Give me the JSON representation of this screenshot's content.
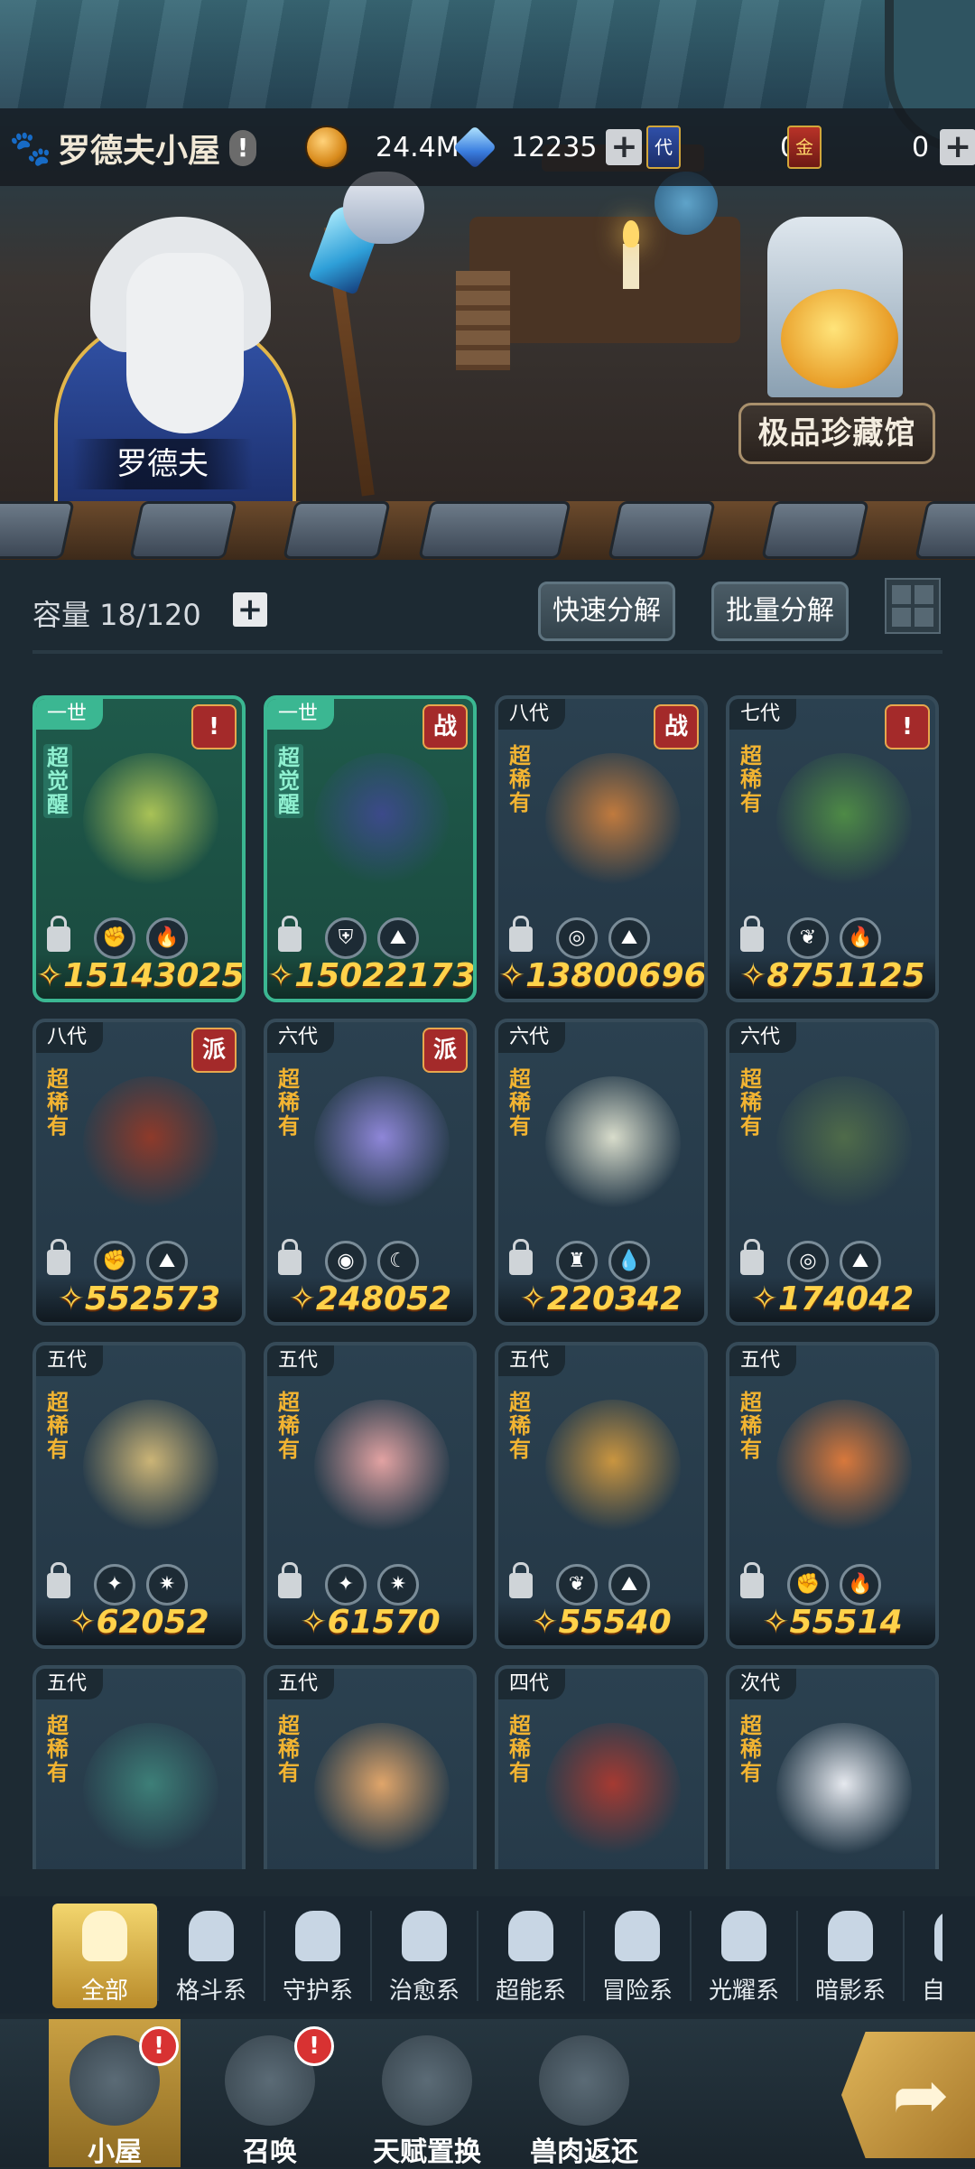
{
  "header": {
    "title": "罗德夫小屋",
    "title_alert": "!",
    "coins": "24.4M",
    "gems": "12235",
    "ticket_gen_label": "代",
    "ticket_gen": "0",
    "ticket_gold_label": "金",
    "ticket_gold": "0",
    "plus": "+"
  },
  "scene": {
    "npc_name": "罗德夫",
    "vault_button": "极品珍藏馆"
  },
  "storage": {
    "capacity_label": "容量 18/120",
    "plus": "+",
    "quick_decompose": "快速分解",
    "batch_decompose": "批量分解"
  },
  "cards": [
    {
      "gen": "一世",
      "badge": "!",
      "badge_type": "alert",
      "rarity": "超觉醒",
      "awake": true,
      "power": "15143025",
      "elements": [
        "fist",
        "fire"
      ],
      "color": "#a9c256"
    },
    {
      "gen": "一世",
      "badge": "战",
      "badge_type": "tag",
      "rarity": "超觉醒",
      "awake": true,
      "power": "15022173",
      "elements": [
        "shield",
        "earth"
      ],
      "color": "#3c4a8a"
    },
    {
      "gen": "八代",
      "badge": "战",
      "badge_type": "tag",
      "rarity": "超稀有",
      "awake": false,
      "power": "13800696",
      "elements": [
        "psychic",
        "earth"
      ],
      "color": "#c07a3e"
    },
    {
      "gen": "七代",
      "badge": "!",
      "badge_type": "alert",
      "rarity": "超稀有",
      "awake": false,
      "power": "8751125",
      "elements": [
        "leaf",
        "fire"
      ],
      "color": "#4e8a46"
    },
    {
      "gen": "八代",
      "badge": "派",
      "badge_type": "tag",
      "rarity": "超稀有",
      "awake": false,
      "power": "552573",
      "elements": [
        "fist",
        "earth"
      ],
      "color": "#8e3a2a"
    },
    {
      "gen": "六代",
      "badge": "派",
      "badge_type": "tag",
      "rarity": "超稀有",
      "awake": false,
      "power": "248052",
      "elements": [
        "eye",
        "moon"
      ],
      "color": "#8e86d8"
    },
    {
      "gen": "六代",
      "badge": "",
      "badge_type": "none",
      "rarity": "超稀有",
      "awake": false,
      "power": "220342",
      "elements": [
        "tower",
        "water"
      ],
      "color": "#d8dccb"
    },
    {
      "gen": "六代",
      "badge": "",
      "badge_type": "none",
      "rarity": "超稀有",
      "awake": false,
      "power": "174042",
      "elements": [
        "psychic",
        "earth"
      ],
      "color": "#4f6b4a"
    },
    {
      "gen": "五代",
      "badge": "",
      "badge_type": "none",
      "rarity": "超稀有",
      "awake": false,
      "power": "62052",
      "elements": [
        "star",
        "sun"
      ],
      "color": "#cbb476"
    },
    {
      "gen": "五代",
      "badge": "",
      "badge_type": "none",
      "rarity": "超稀有",
      "awake": false,
      "power": "61570",
      "elements": [
        "star",
        "sun"
      ],
      "color": "#e2a2a2"
    },
    {
      "gen": "五代",
      "badge": "",
      "badge_type": "none",
      "rarity": "超稀有",
      "awake": false,
      "power": "55540",
      "elements": [
        "leaf",
        "earth"
      ],
      "color": "#c99540"
    },
    {
      "gen": "五代",
      "badge": "",
      "badge_type": "none",
      "rarity": "超稀有",
      "awake": false,
      "power": "55514",
      "elements": [
        "fist",
        "fire"
      ],
      "color": "#d8783c"
    },
    {
      "gen": "五代",
      "badge": "",
      "badge_type": "none",
      "rarity": "超稀有",
      "awake": false,
      "power": "",
      "elements": [],
      "color": "#3d7f78"
    },
    {
      "gen": "五代",
      "badge": "",
      "badge_type": "none",
      "rarity": "超稀有",
      "awake": false,
      "power": "",
      "elements": [],
      "color": "#e0a56a"
    },
    {
      "gen": "四代",
      "badge": "",
      "badge_type": "none",
      "rarity": "超稀有",
      "awake": false,
      "power": "",
      "elements": [],
      "color": "#a53a32"
    },
    {
      "gen": "次代",
      "badge": "",
      "badge_type": "none",
      "rarity": "超稀有",
      "awake": false,
      "power": "",
      "elements": [],
      "color": "#e6e9ef"
    }
  ],
  "categories": [
    {
      "label": "全部",
      "icon": "all-icon",
      "active": true
    },
    {
      "label": "格斗系",
      "icon": "fist-icon",
      "active": false
    },
    {
      "label": "守护系",
      "icon": "shield-icon",
      "active": false
    },
    {
      "label": "治愈系",
      "icon": "sprout-icon",
      "active": false
    },
    {
      "label": "超能系",
      "icon": "psychic-icon",
      "active": false
    },
    {
      "label": "冒险系",
      "icon": "tower-icon",
      "active": false
    },
    {
      "label": "光耀系",
      "icon": "star-icon",
      "active": false
    },
    {
      "label": "暗影系",
      "icon": "eye-icon",
      "active": false
    },
    {
      "label": "自然系",
      "icon": "leaf-icon",
      "active": false
    }
  ],
  "nav": [
    {
      "label": "小屋",
      "icon": "house-icon",
      "active": true,
      "alert": "!"
    },
    {
      "label": "召唤",
      "icon": "egg-icon",
      "active": false,
      "alert": "!"
    },
    {
      "label": "天赋置换",
      "icon": "swap-icon",
      "active": false,
      "alert": ""
    },
    {
      "label": "兽肉返还",
      "icon": "meat-icon",
      "active": false,
      "alert": ""
    }
  ],
  "element_glyphs": {
    "fist": "✊",
    "fire": "🔥",
    "shield": "⛨",
    "earth": "⛰",
    "psychic": "◎",
    "leaf": "❦",
    "eye": "◉",
    "moon": "☾",
    "tower": "♜",
    "water": "💧",
    "star": "✦",
    "sun": "✷"
  }
}
